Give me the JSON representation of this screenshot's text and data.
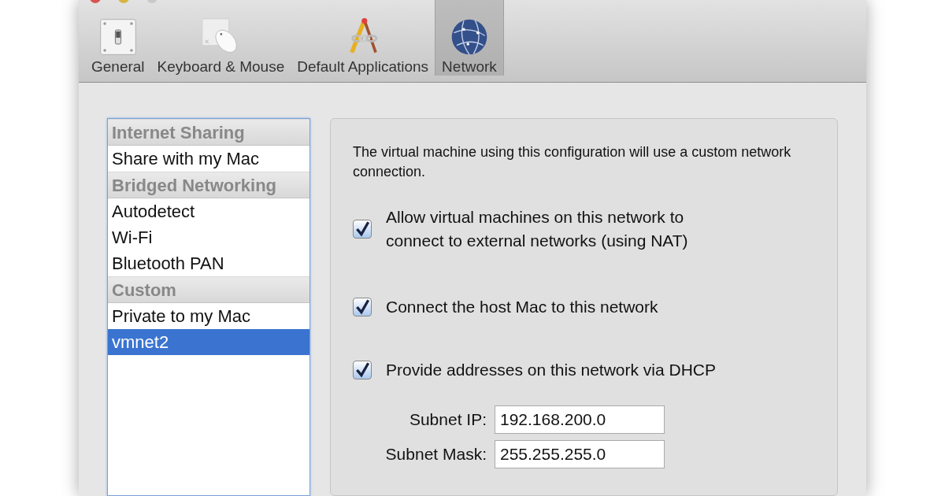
{
  "toolbar": [
    {
      "label": "General",
      "kind": "switch",
      "selected": false
    },
    {
      "label": "Keyboard & Mouse",
      "kind": "mouse",
      "selected": false
    },
    {
      "label": "Default Applications",
      "kind": "tools",
      "selected": false
    },
    {
      "label": "Network",
      "kind": "globe",
      "selected": true
    }
  ],
  "network_list": [
    {
      "kind": "header",
      "label": "Internet Sharing"
    },
    {
      "kind": "item",
      "label": "Share with my Mac",
      "selected": false
    },
    {
      "kind": "header",
      "label": "Bridged Networking"
    },
    {
      "kind": "item",
      "label": "Autodetect",
      "selected": false
    },
    {
      "kind": "item",
      "label": "Wi-Fi",
      "selected": false
    },
    {
      "kind": "item",
      "label": "Bluetooth PAN",
      "selected": false
    },
    {
      "kind": "header",
      "label": "Custom"
    },
    {
      "kind": "item",
      "label": "Private to my Mac",
      "selected": false
    },
    {
      "kind": "item",
      "label": "vmnet2",
      "selected": true
    }
  ],
  "panel": {
    "description": "The virtual machine using this configuration will use a custom network connection.",
    "options": [
      {
        "label": "Allow virtual machines on this network to connect to external networks (using NAT)",
        "checked": true
      },
      {
        "label": "Connect the host Mac to this network",
        "checked": true
      },
      {
        "label": "Provide addresses on this network via DHCP",
        "checked": true
      }
    ],
    "fields": [
      {
        "label": "Subnet IP:",
        "value": "192.168.200.0"
      },
      {
        "label": "Subnet Mask:",
        "value": "255.255.255.0"
      }
    ]
  }
}
